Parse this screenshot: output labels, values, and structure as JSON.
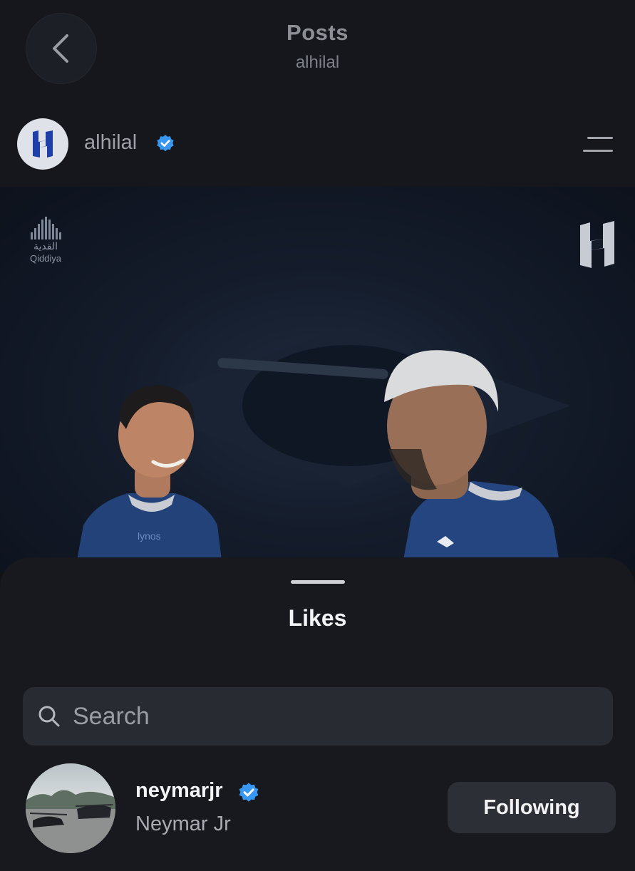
{
  "header": {
    "title": "Posts",
    "subtitle": "alhilal"
  },
  "account": {
    "username": "alhilal",
    "verified": true
  },
  "post": {
    "sponsor_arabic": "القدية",
    "sponsor_english": "Qiddiya",
    "jersey_text": "lynos"
  },
  "likes_sheet": {
    "title": "Likes",
    "search_placeholder": "Search",
    "users": [
      {
        "username": "neymarjr",
        "full_name": "Neymar Jr",
        "verified": true,
        "action_label": "Following"
      }
    ]
  },
  "colors": {
    "background": "#111317",
    "sheet": "#17191e",
    "verified_blue": "#3897f0",
    "club_blue": "#1f3fa8"
  },
  "icons": [
    "chevron-left-icon",
    "verified-badge-icon",
    "menu-icon",
    "search-icon",
    "club-logo-icon"
  ]
}
